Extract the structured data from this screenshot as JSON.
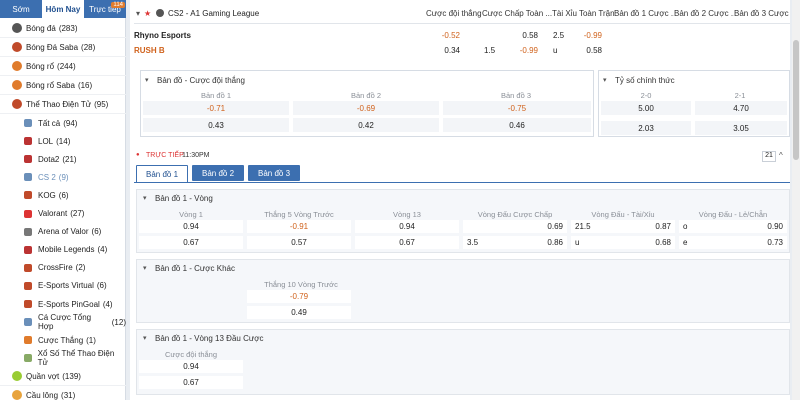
{
  "tabs": [
    {
      "label": "Sớm"
    },
    {
      "label": "Hôm Nay"
    },
    {
      "label": "Trực tiếp",
      "badge": "114"
    }
  ],
  "sports": [
    {
      "label": "Bóng đá",
      "count": "(283)",
      "color": "#555"
    },
    {
      "label": "Bóng Đá Saba",
      "count": "(28)",
      "color": "#c04a2a"
    },
    {
      "label": "Bóng rổ",
      "count": "(244)",
      "color": "#e07b2c"
    },
    {
      "label": "Bóng rổ Saba",
      "count": "(16)",
      "color": "#e07b2c"
    },
    {
      "label": "Thể Thao Điện Tử",
      "count": "(95)",
      "color": "#c04a2a"
    }
  ],
  "esports": [
    {
      "label": "Tất cả",
      "count": "(94)",
      "color": "#6a8fb9"
    },
    {
      "label": "LOL",
      "count": "(14)",
      "color": "#b33"
    },
    {
      "label": "Dota2",
      "count": "(21)",
      "color": "#b33"
    },
    {
      "label": "CS 2",
      "count": "(9)",
      "color": "#6a8fb9"
    },
    {
      "label": "KOG",
      "count": "(6)",
      "color": "#c04a2a"
    },
    {
      "label": "Valorant",
      "count": "(27)",
      "color": "#d33"
    },
    {
      "label": "Arena of Valor",
      "count": "(6)",
      "color": "#777"
    },
    {
      "label": "Mobile Legends",
      "count": "(4)",
      "color": "#b33"
    },
    {
      "label": "CrossFire",
      "count": "(2)",
      "color": "#c04a2a"
    },
    {
      "label": "E-Sports Virtual",
      "count": "(6)",
      "color": "#c04a2a"
    },
    {
      "label": "E-Sports PinGoal",
      "count": "(4)",
      "color": "#c04a2a"
    },
    {
      "label": "Cá Cược Tổng Hợp",
      "count": "(12)",
      "color": "#6a8fb9"
    },
    {
      "label": "Cược Thắng",
      "count": "(1)",
      "color": "#e07b2c"
    },
    {
      "label": "Xổ Số Thể Thao Điện Tử",
      "count": "",
      "color": "#8a6"
    }
  ],
  "sports_bottom": [
    {
      "label": "Quần vợt",
      "count": "(139)",
      "color": "#9c3"
    },
    {
      "label": "Cầu lông",
      "count": "(31)",
      "color": "#e8a33c"
    }
  ],
  "league": {
    "title": "CS2 - A1 Gaming League"
  },
  "columns": [
    "Cược đội thắng",
    "Cược Chấp Toàn ...",
    "Tài Xỉu Toàn Trận",
    "Bản đồ 1 Cược ...",
    "Bản đồ 2 Cược ...",
    "Bản đồ 3 Cược ..."
  ],
  "teams": [
    {
      "name": "Rhyno Esports",
      "moneyline": "-0.52",
      "hcap_line": "",
      "hcap": "0.58",
      "ou_line": "2.5",
      "ou": "-0.99"
    },
    {
      "name": "RUSH B",
      "moneyline": "0.34",
      "hcap_line": "1.5",
      "hcap": "-0.99",
      "ou_line": "u",
      "ou": "0.58"
    }
  ],
  "map_winner": {
    "title": "Bản đồ - Cược đội thắng",
    "headers": [
      "Bản đồ 1",
      "Bản đồ 2",
      "Bản đồ 3"
    ],
    "row1": [
      "-0.71",
      "-0.69",
      "-0.75"
    ],
    "row2": [
      "0.43",
      "0.42",
      "0.46"
    ]
  },
  "correct_score": {
    "title": "Tỷ số chính thức",
    "headers": [
      "2-0",
      "2-1"
    ],
    "row1": [
      "5.00",
      "4.70"
    ],
    "row2": [
      "2.03",
      "3.05"
    ]
  },
  "live": {
    "label": "TRỰC TIẾP",
    "time": "11:30PM",
    "count": "21"
  },
  "map_tabs": [
    "Bản đồ 1",
    "Bản đồ 2",
    "Bản đồ 3"
  ],
  "sect_rounds": {
    "title": "Bản đồ 1 - Vòng",
    "headers": [
      "Vòng 1",
      "Thắng 5 Vòng Trước",
      "Vòng 13",
      "Vòng Đấu Cược Chấp",
      "Vòng Đấu - Tài/Xỉu",
      "Vòng Đấu - Lẻ/Chẵn"
    ],
    "row1": {
      "v1": "0.94",
      "t5": "-0.91",
      "v13": "0.94",
      "hc_line": "",
      "hc": "0.69",
      "ou_line": "21.5",
      "ou": "0.87",
      "oe_line": "o",
      "oe": "0.90"
    },
    "row2": {
      "v1": "0.67",
      "t5": "0.57",
      "v13": "0.67",
      "hc_line": "3.5",
      "hc": "0.86",
      "ou_line": "u",
      "ou": "0.68",
      "oe_line": "e",
      "oe": "0.73"
    }
  },
  "sect_other": {
    "title": "Bản đồ 1 - Cược Khác",
    "header": "Thắng 10 Vòng Trước",
    "row1": "-0.79",
    "row2": "0.49"
  },
  "sect_13": {
    "title": "Bản đồ 1 - Vòng 13 Đầu Cược",
    "header": "Cược đội thắng",
    "row1": "0.94",
    "row2": "0.67"
  }
}
